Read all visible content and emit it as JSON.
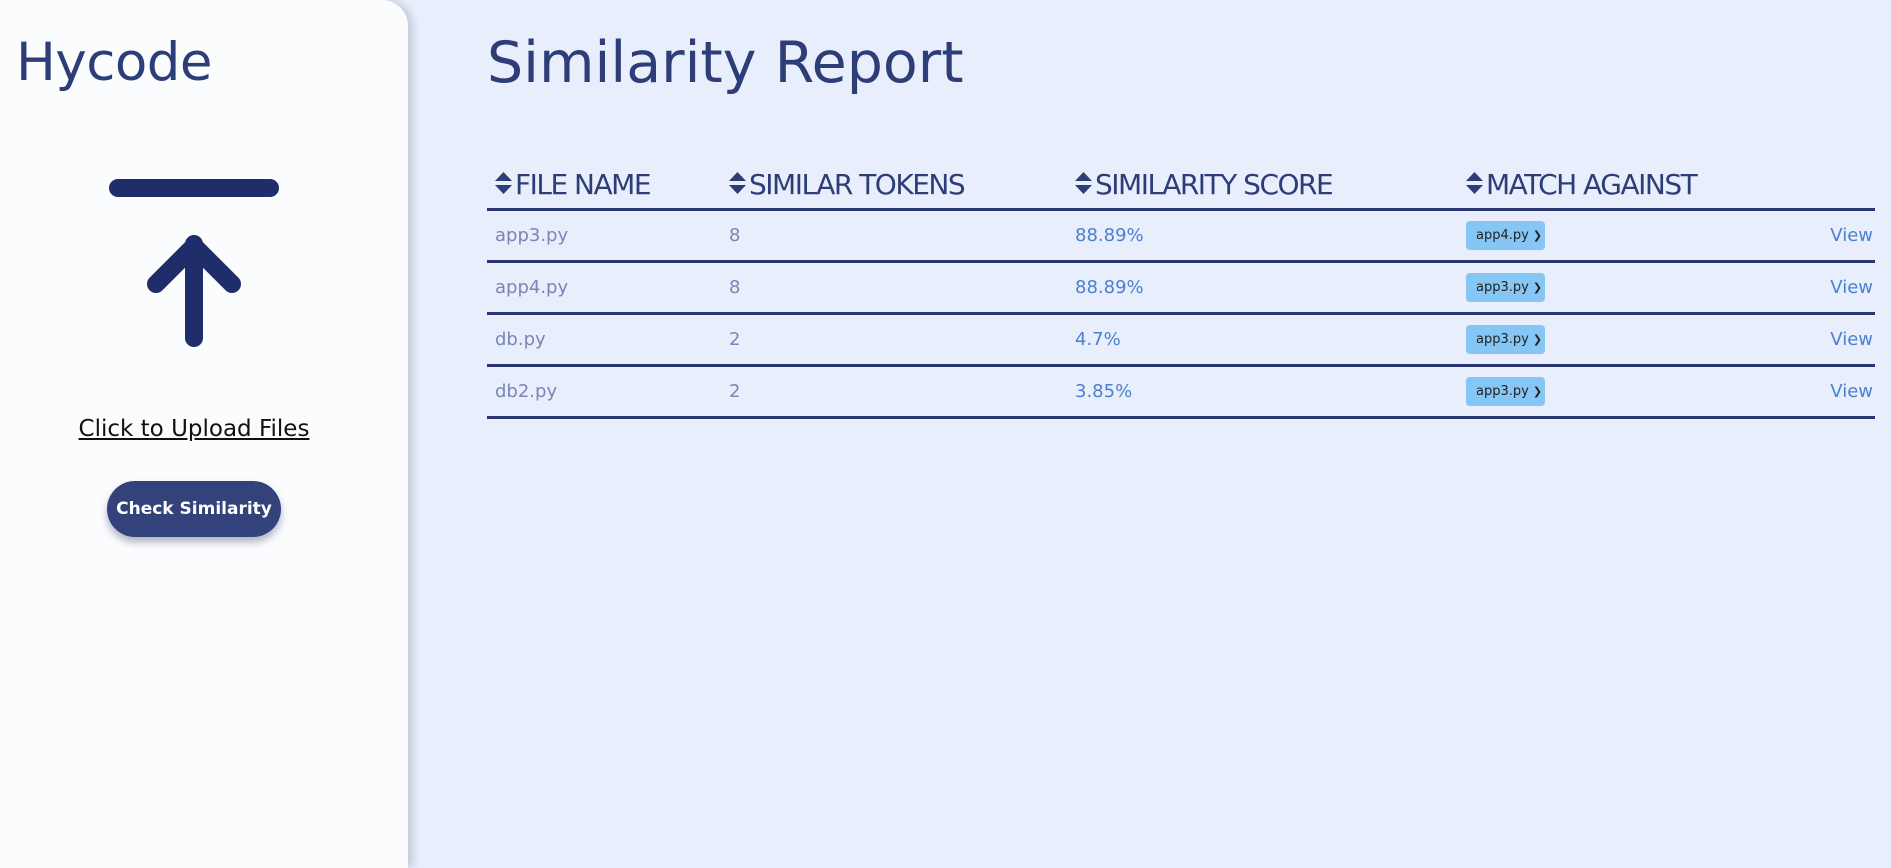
{
  "sidebar": {
    "brand": "Hycode",
    "upload_icon": "upload-arrow-icon",
    "upload_label": "Click to Upload Files",
    "check_button": "Check Similarity"
  },
  "main": {
    "title": "Similarity Report",
    "columns": [
      "FILE NAME",
      "SIMILAR TOKENS",
      "SIMILARITY SCORE",
      "MATCH AGAINST"
    ],
    "sort_icon": "sort-updown-icon",
    "rows": [
      {
        "file": "app3.py",
        "tokens": "8",
        "score": "88.89%",
        "match": "app4.py",
        "action": "View"
      },
      {
        "file": "app4.py",
        "tokens": "8",
        "score": "88.89%",
        "match": "app3.py",
        "action": "View"
      },
      {
        "file": "db.py",
        "tokens": "2",
        "score": "4.7%",
        "match": "app3.py",
        "action": "View"
      },
      {
        "file": "db2.py",
        "tokens": "2",
        "score": "3.85%",
        "match": "app3.py",
        "action": "View"
      }
    ]
  },
  "colors": {
    "background": "#e8eefb",
    "sidebar": "#fbfcfe",
    "primary": "#2d3d78",
    "button": "#33427a",
    "link": "#4a80d0",
    "select": "#86c6f4"
  }
}
